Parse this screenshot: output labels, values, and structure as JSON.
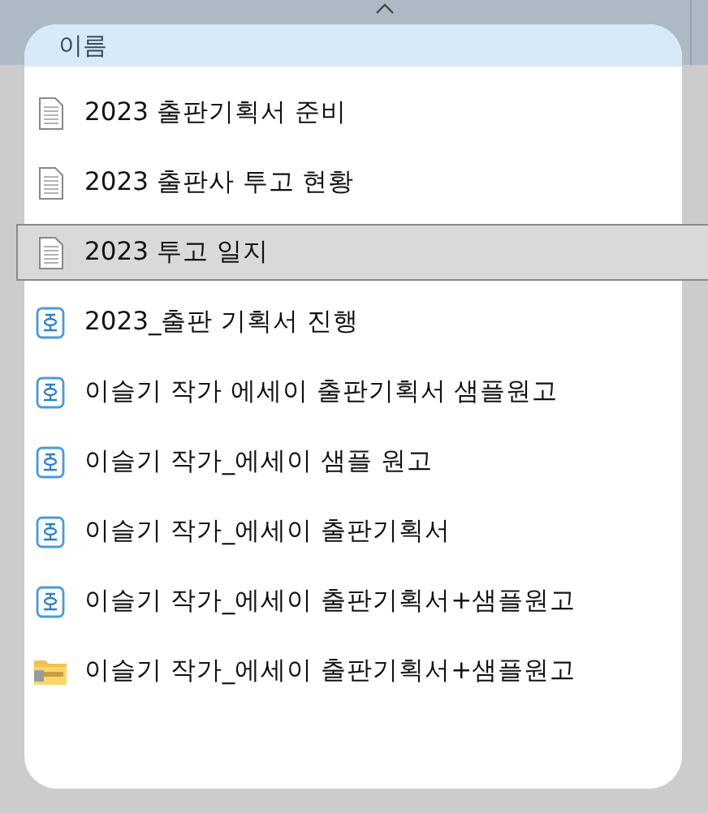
{
  "header": {
    "column": "이름"
  },
  "files": [
    {
      "name": "2023 출판기획서 준비",
      "kind": "text",
      "selected": false
    },
    {
      "name": "2023 출판사 투고 현황",
      "kind": "text",
      "selected": false
    },
    {
      "name": "2023 투고 일지",
      "kind": "text",
      "selected": true
    },
    {
      "name": "2023_출판 기획서 진행",
      "kind": "hwp",
      "selected": false
    },
    {
      "name": "이슬기 작가 에세이 출판기획서 샘플원고",
      "kind": "hwp",
      "selected": false
    },
    {
      "name": "이슬기 작가_에세이 샘플 원고",
      "kind": "hwp",
      "selected": false
    },
    {
      "name": "이슬기 작가_에세이 출판기획서",
      "kind": "hwp",
      "selected": false
    },
    {
      "name": "이슬기 작가_에세이 출판기획서+샘플원고",
      "kind": "hwp",
      "selected": false
    },
    {
      "name": "이슬기 작가_에세이 출판기획서+샘플원고",
      "kind": "zip",
      "selected": false
    }
  ]
}
